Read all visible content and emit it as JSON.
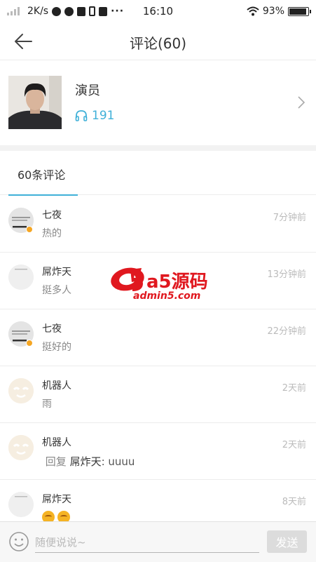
{
  "status_bar": {
    "speed": "2K/s",
    "time": "16:10",
    "battery": "93%",
    "battery_level": 0.93
  },
  "header": {
    "title": "评论(60)"
  },
  "artist": {
    "name": "演员",
    "play_count": "191"
  },
  "tabs": [
    {
      "label": "60条评论",
      "active": true
    }
  ],
  "comments": [
    {
      "user": "七夜",
      "time": "7分钟前",
      "text": "热的",
      "avatar": "grey-avatar",
      "badge": true
    },
    {
      "user": "屌炸天",
      "time": "13分钟前",
      "text": "挺多人",
      "avatar": "light-avatar",
      "badge": false
    },
    {
      "user": "七夜",
      "time": "22分钟前",
      "text": "挺好的",
      "avatar": "grey-avatar",
      "badge": true
    },
    {
      "user": "机器人",
      "time": "2天前",
      "text": "雨",
      "avatar": "robot-avatar",
      "badge": false
    },
    {
      "user": "机器人",
      "time": "2天前",
      "reply_label": "回复",
      "reply_to": "屌炸天",
      "reply_text": ": uuuu",
      "avatar": "robot-avatar",
      "badge": false
    },
    {
      "user": "屌炸天",
      "time": "8天前",
      "emoji": [
        "smile-emoji",
        "smile-emoji"
      ],
      "avatar": "light-avatar",
      "badge": false
    }
  ],
  "watermark": {
    "brand": "a5源码",
    "url": "admin5.com"
  },
  "input_bar": {
    "placeholder": "随便说说~",
    "value": "",
    "send_label": "发送"
  },
  "colors": {
    "accent": "#3fb0d8",
    "divider": "#ececec",
    "muted": "#bbbbbb",
    "badge": "#f5a623",
    "watermark_red": "#e0181f"
  }
}
